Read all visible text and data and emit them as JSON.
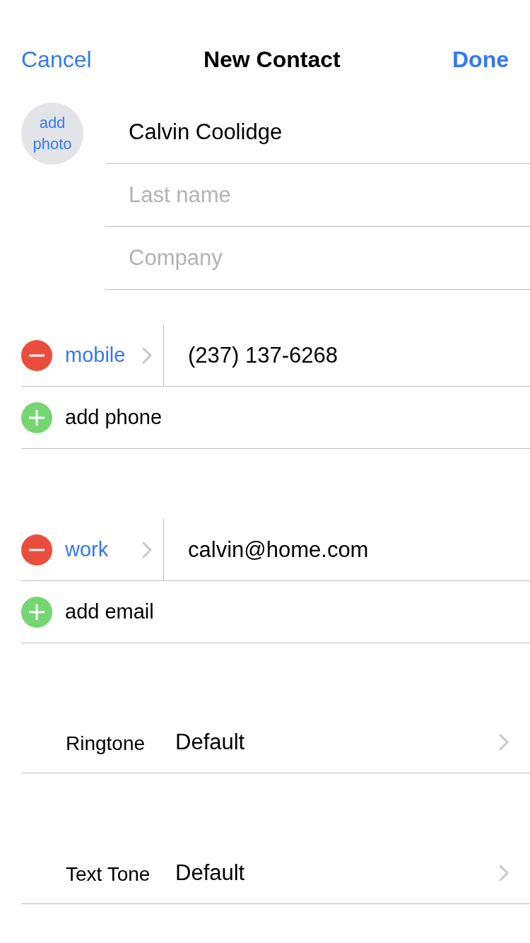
{
  "nav": {
    "cancel": "Cancel",
    "title": "New Contact",
    "done": "Done"
  },
  "avatar": {
    "label": "add photo"
  },
  "name_fields": [
    {
      "value": "Calvin Coolidge"
    },
    {
      "placeholder": "Last name"
    },
    {
      "placeholder": "Company"
    }
  ],
  "phone_section": {
    "entries": [
      {
        "label": "mobile",
        "value": "(237) 137-6268"
      }
    ],
    "add_label": "add phone"
  },
  "email_section": {
    "entries": [
      {
        "label": "work",
        "value": "calvin@home.com"
      }
    ],
    "add_label": "add email"
  },
  "tones": [
    {
      "label": "Ringtone",
      "value": "Default"
    },
    {
      "label": "Text Tone",
      "value": "Default"
    }
  ]
}
